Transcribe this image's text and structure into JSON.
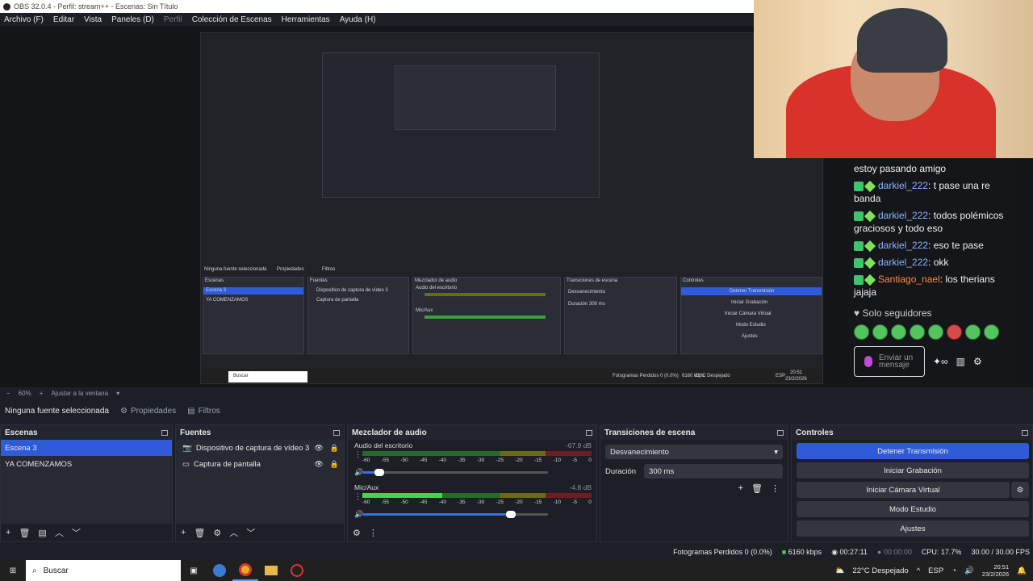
{
  "window": {
    "title": "OBS 32.0.4 - Perfil: stream++ - Escenas: Sin Título"
  },
  "menu": [
    {
      "label": "Archivo (F)",
      "dim": false
    },
    {
      "label": "Editar",
      "dim": false
    },
    {
      "label": "Vista",
      "dim": false
    },
    {
      "label": "Paneles (D)",
      "dim": false
    },
    {
      "label": "Perfil",
      "dim": true
    },
    {
      "label": "Colección de Escenas",
      "dim": false
    },
    {
      "label": "Herramientas",
      "dim": false
    },
    {
      "label": "Ayuda (H)",
      "dim": false
    }
  ],
  "preview": {
    "nested_labels": {
      "scenes": "Escenas",
      "sources": "Fuentes",
      "mixer": "Mezclador de audio",
      "transitions": "Transiciones de escena",
      "controls": "Controles",
      "scene1": "Escena 3",
      "scene2": "YA COMENZAMOS",
      "source1": "Dispositivo de captura de vídeo 3",
      "source2": "Captura de pantalla",
      "desktop_audio": "Audio del escritorio",
      "mic": "Mic/Aux",
      "fade": "Desvanecimiento",
      "duration": "Duración",
      "duration_val": "300 ms",
      "stop_stream": "Detener Transmisión",
      "start_rec": "Iniciar Grabación",
      "virtual_cam": "Iniciar Cámara Virtual",
      "studio": "Modo Estudio",
      "settings": "Ajustes",
      "no_source": "Ninguna fuente seleccionada",
      "properties": "Propiedades",
      "filters": "Filtros",
      "zoom": "60%",
      "fit": "Ajustar a la ventana",
      "search": "Buscar",
      "dropped": "Fotogramas Perdidos 0 (0.0%)",
      "kbps": "6160 kbps",
      "weather": "22°C Despejado",
      "lang": "ESP",
      "time": "20:51",
      "date": "23/2/2026"
    }
  },
  "chat": {
    "messages": [
      {
        "user": "",
        "text": "estoy pasando amigo",
        "color": "none"
      },
      {
        "user": "darkiel_222",
        "text": ": t pase una re banda",
        "color": "blue"
      },
      {
        "user": "darkiel_222",
        "text": ": todos polémicos graciosos y todo eso",
        "color": "blue"
      },
      {
        "user": "darkiel_222",
        "text": ": eso te pase",
        "color": "blue"
      },
      {
        "user": "darkiel_222",
        "text": ": okk",
        "color": "blue"
      },
      {
        "user": "Santiago_nael",
        "text": ": los therians jajaja",
        "color": "orange"
      }
    ],
    "followers_only": "Solo seguidores",
    "send_placeholder": "Enviar un mensaje"
  },
  "zoombar": {
    "zoom": "60%",
    "fit": "Ajustar a la ventana"
  },
  "propbar": {
    "no_source": "Ninguna fuente seleccionada",
    "properties": "Propiedades",
    "filters": "Filtros"
  },
  "docks": {
    "scenes": {
      "title": "Escenas",
      "items": [
        {
          "label": "Escena 3",
          "active": true
        },
        {
          "label": "YA COMENZAMOS",
          "active": false
        }
      ]
    },
    "sources": {
      "title": "Fuentes",
      "items": [
        {
          "label": "Dispositivo de captura de vídeo 3",
          "icon": "camera-icon"
        },
        {
          "label": "Captura de pantalla",
          "icon": "monitor-icon"
        }
      ]
    },
    "mixer": {
      "title": "Mezclador de audio",
      "channels": [
        {
          "name": "Audio del escritorio",
          "db": "-67.9 dB",
          "level": 0.0,
          "volume": 0.09
        },
        {
          "name": "Mic/Aux",
          "db": "-4.8 dB",
          "level": 0.35,
          "volume": 0.8
        }
      ],
      "ticks": [
        "-60",
        "-55",
        "-50",
        "-45",
        "-40",
        "-35",
        "-30",
        "-25",
        "-20",
        "-15",
        "-10",
        "-5",
        "0"
      ]
    },
    "transitions": {
      "title": "Transiciones de escena",
      "type": "Desvanecimiento",
      "duration_label": "Duración",
      "duration": "300 ms"
    },
    "controls": {
      "title": "Controles",
      "buttons": [
        {
          "label": "Detener Transmisión",
          "active": true
        },
        {
          "label": "Iniciar Grabación",
          "active": false
        },
        {
          "label": "Iniciar Cámara Virtual",
          "active": false
        },
        {
          "label": "Modo Estudio",
          "active": false
        },
        {
          "label": "Ajustes",
          "active": false
        }
      ]
    }
  },
  "status": {
    "dropped": "Fotogramas Perdidos 0 (0.0%)",
    "kbps": "6160 kbps",
    "stream_time": "00:27:11",
    "rec_time": "00:00:00",
    "cpu": "CPU: 17.7%",
    "fps": "30.00 / 30.00 FPS"
  },
  "taskbar": {
    "search": "Buscar",
    "weather": "22°C Despejado",
    "lang": "ESP",
    "time": "20:51",
    "date": "23/2/2026"
  },
  "colors": {
    "accent": "#2f5bd8",
    "chat_user_blue": "#8ab4ff",
    "chat_user_orange": "#ff8a3d",
    "meter_green": "#4bd14f"
  }
}
